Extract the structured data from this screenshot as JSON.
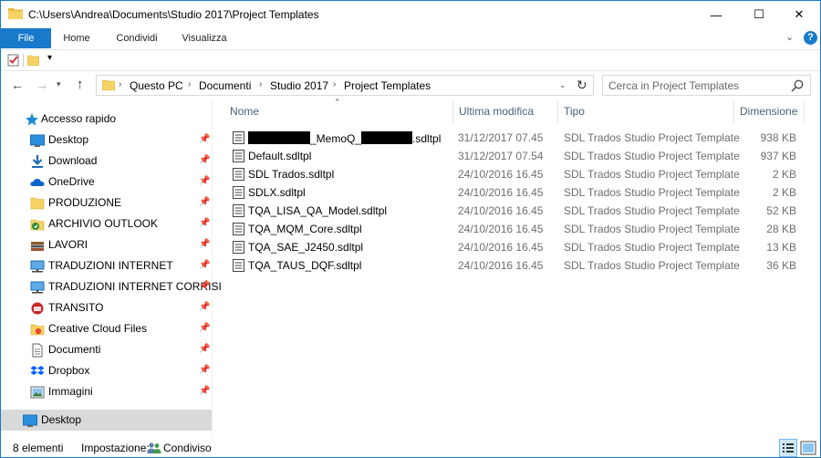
{
  "window": {
    "title": "C:\\Users\\Andrea\\Documents\\Studio 2017\\Project Templates",
    "minimize_glyph": "—",
    "maximize_glyph": "☐",
    "close_glyph": "✕"
  },
  "ribbon": {
    "tabs": [
      {
        "label": "File"
      },
      {
        "label": "Home"
      },
      {
        "label": "Condividi"
      },
      {
        "label": "Visualizza"
      }
    ],
    "help_label": "?"
  },
  "nav": {
    "breadcrumbs": [
      "Questo PC",
      "Documenti",
      "Studio 2017",
      "Project Templates"
    ],
    "search_placeholder": "Cerca in Project Templates"
  },
  "sidebar": {
    "quick_access_label": "Accesso rapido",
    "items": [
      {
        "label": "Desktop",
        "icon": "desktop-icon",
        "pinned": true
      },
      {
        "label": "Download",
        "icon": "download-icon",
        "pinned": true
      },
      {
        "label": "OneDrive",
        "icon": "onedrive-icon",
        "pinned": true
      },
      {
        "label": "PRODUZIONE",
        "icon": "folder-icon",
        "pinned": true
      },
      {
        "label": "ARCHIVIO OUTLOOK",
        "icon": "archive-icon",
        "pinned": true
      },
      {
        "label": "LAVORI",
        "icon": "books-icon",
        "pinned": true
      },
      {
        "label": "TRADUZIONI INTERNET",
        "icon": "network-folder-icon",
        "pinned": true
      },
      {
        "label": "TRADUZIONI INTERNET CORRISI",
        "icon": "network-folder-icon",
        "pinned": true
      },
      {
        "label": "TRANSITO",
        "icon": "transit-icon",
        "pinned": true
      },
      {
        "label": "Creative Cloud Files",
        "icon": "creative-cloud-icon",
        "pinned": true
      },
      {
        "label": "Documenti",
        "icon": "documents-icon",
        "pinned": true
      },
      {
        "label": "Dropbox",
        "icon": "dropbox-icon",
        "pinned": true
      },
      {
        "label": "Immagini",
        "icon": "pictures-icon",
        "pinned": true
      }
    ],
    "selected": {
      "label": "Desktop",
      "icon": "desktop-icon"
    }
  },
  "columns": {
    "name": "Nome",
    "modified": "Ultima modifica",
    "type": "Tipo",
    "size": "Dimensione"
  },
  "files": [
    {
      "name_parts": [
        "",
        "_MemoQ_",
        ".sdltpl"
      ],
      "redacted": true,
      "modified": "31/12/2017 07.45",
      "type": "SDL Trados Studio Project Template",
      "size": "938 KB"
    },
    {
      "name": "Default.sdltpl",
      "modified": "31/12/2017 07.54",
      "type": "SDL Trados Studio Project Template",
      "size": "937 KB"
    },
    {
      "name": "SDL Trados.sdltpl",
      "modified": "24/10/2016 16.45",
      "type": "SDL Trados Studio Project Template",
      "size": "2 KB"
    },
    {
      "name": "SDLX.sdltpl",
      "modified": "24/10/2016 16.45",
      "type": "SDL Trados Studio Project Template",
      "size": "2 KB"
    },
    {
      "name": "TQA_LISA_QA_Model.sdltpl",
      "modified": "24/10/2016 16.45",
      "type": "SDL Trados Studio Project Template",
      "size": "52 KB"
    },
    {
      "name": "TQA_MQM_Core.sdltpl",
      "modified": "24/10/2016 16.45",
      "type": "SDL Trados Studio Project Template",
      "size": "28 KB"
    },
    {
      "name": "TQA_SAE_J2450.sdltpl",
      "modified": "24/10/2016 16.45",
      "type": "SDL Trados Studio Project Template",
      "size": "13 KB"
    },
    {
      "name": "TQA_TAUS_DQF.sdltpl",
      "modified": "24/10/2016 16.45",
      "type": "SDL Trados Studio Project Template",
      "size": "36 KB"
    }
  ],
  "status": {
    "count": "8 elementi",
    "sharing_label": "Impostazione:",
    "sharing_value": "Condiviso"
  },
  "colors": {
    "accent": "#1979ca",
    "folder": "#f6d264",
    "header_text": "#4c607a",
    "selected_bg": "#d9d9d9"
  }
}
